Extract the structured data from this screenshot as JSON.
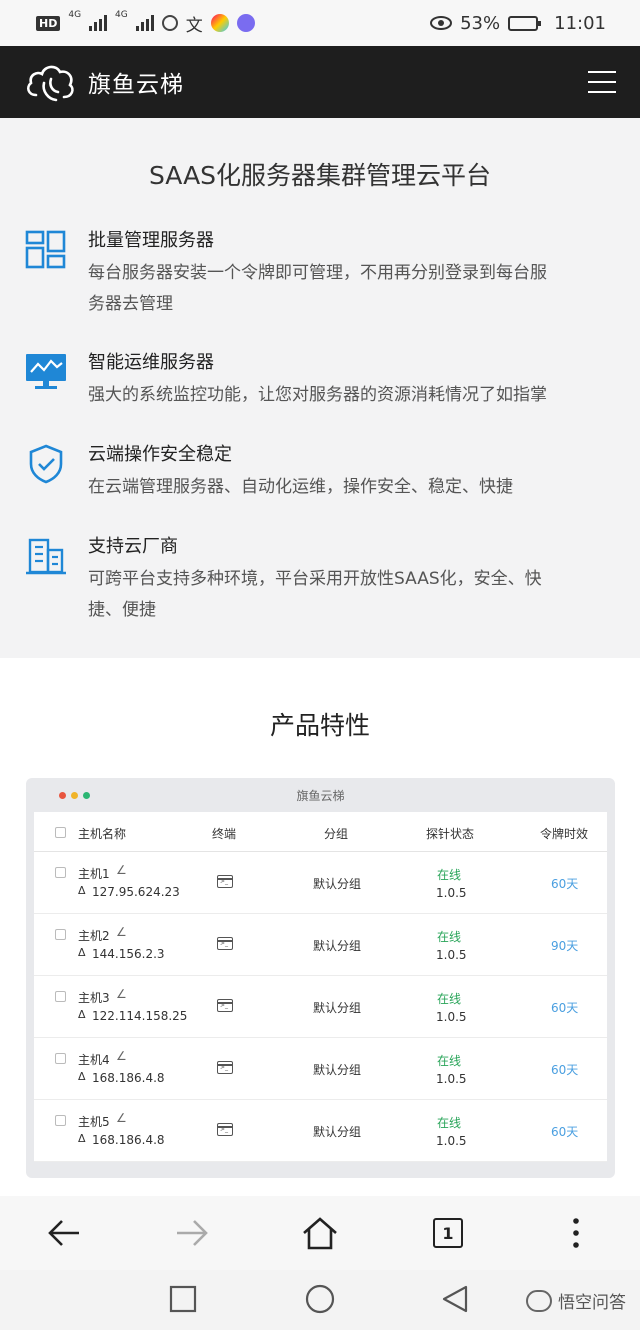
{
  "status_bar": {
    "hd": "HD",
    "network": [
      "4G",
      "4G"
    ],
    "battery_percent": "53%",
    "time": "11:01",
    "battery_level": 0.53
  },
  "header": {
    "brand": "旗鱼云梯",
    "logo_icon": "cloud-logo-icon",
    "menu_icon": "hamburger-menu-icon"
  },
  "features": {
    "title": "SAAS化服务器集群管理云平台",
    "items": [
      {
        "icon": "grid-servers-icon",
        "title": "批量管理服务器",
        "desc": [
          "每台服务器安装一个令牌即可管理，不用再分别登录到每台服",
          "务器去管理"
        ]
      },
      {
        "icon": "monitor-chart-icon",
        "title": "智能运维服务器",
        "desc": [
          "强大的系统监控功能，让您对服务器的资源消耗情况了如指掌"
        ]
      },
      {
        "icon": "shield-check-icon",
        "title": "云端操作安全稳定",
        "desc": [
          "在云端管理服务器、自动化运维，操作安全、稳定、快捷"
        ]
      },
      {
        "icon": "building-icon",
        "title": "支持云厂商",
        "desc": [
          "可跨平台支持多种环境，平台采用开放性SAAS化，安全、快",
          "捷、便捷"
        ]
      }
    ]
  },
  "product": {
    "title": "产品特性",
    "mock": {
      "window_title": "旗鱼云梯",
      "dot_colors": [
        "#e8553f",
        "#f0b429",
        "#2bb673"
      ],
      "columns": [
        "主机名称",
        "终端",
        "分组",
        "探针状态",
        "令牌时效"
      ],
      "rows": [
        {
          "name": "主机1",
          "ip": "127.95.624.23",
          "group": "默认分组",
          "status": "在线",
          "version": "1.0.5",
          "token": "60天"
        },
        {
          "name": "主机2",
          "ip": "144.156.2.3",
          "group": "默认分组",
          "status": "在线",
          "version": "1.0.5",
          "token": "90天"
        },
        {
          "name": "主机3",
          "ip": "122.114.158.25",
          "group": "默认分组",
          "status": "在线",
          "version": "1.0.5",
          "token": "60天"
        },
        {
          "name": "主机4",
          "ip": "168.186.4.8",
          "group": "默认分组",
          "status": "在线",
          "version": "1.0.5",
          "token": "60天"
        },
        {
          "name": "主机5",
          "ip": "168.186.4.8",
          "group": "默认分组",
          "status": "在线",
          "version": "1.0.5",
          "token": "60天"
        }
      ]
    }
  },
  "browser_toolbar": {
    "tab_count": "1",
    "icons": [
      "back-arrow-icon",
      "forward-arrow-icon",
      "home-icon",
      "tabs-icon",
      "more-vertical-icon"
    ]
  },
  "system_nav": {
    "watermark": "悟空问答",
    "icons": [
      "recents-square-icon",
      "home-circle-icon",
      "back-triangle-icon"
    ]
  },
  "colors": {
    "header_bg": "#1e1e1e",
    "accent_blue": "#1f87d6",
    "online_green": "#2aa55a",
    "token_blue": "#4a9fe0"
  }
}
